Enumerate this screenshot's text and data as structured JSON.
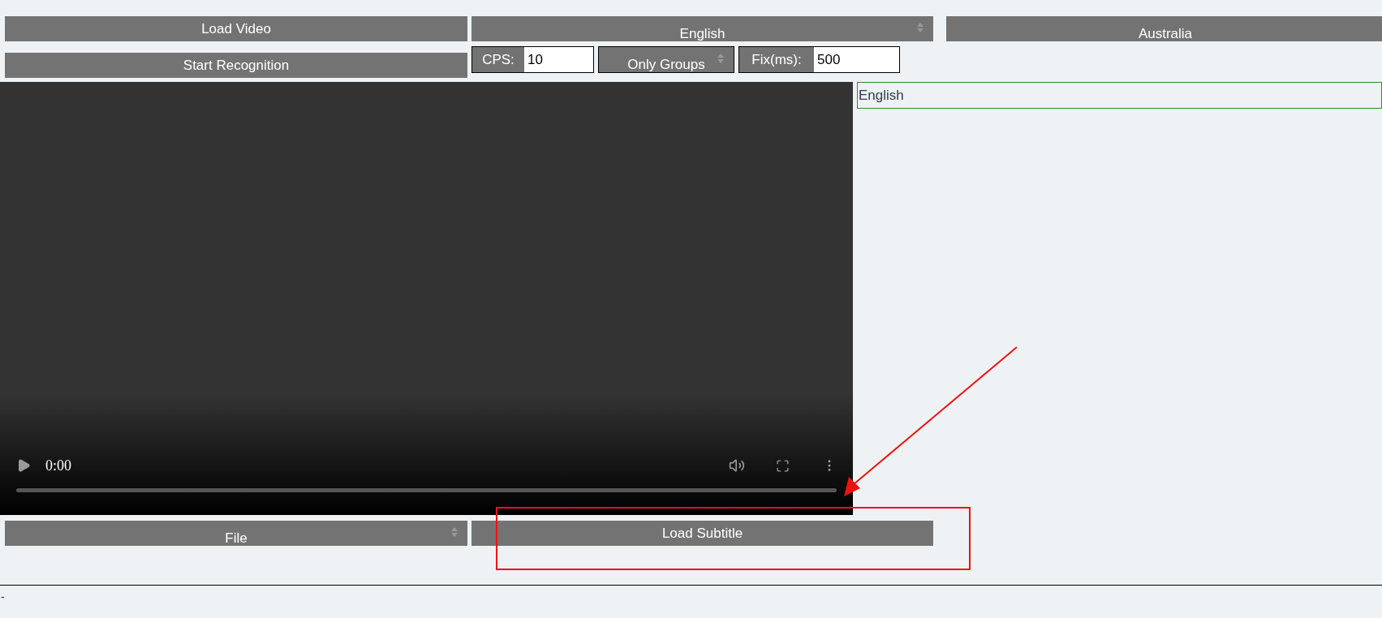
{
  "toolbar": {
    "load_video_button": "Load Video",
    "language_select": {
      "value": "English"
    },
    "region_select": {
      "value": "Australia"
    },
    "start_recognition_button": "Start Recognition",
    "cps": {
      "label": "CPS:",
      "value": "10"
    },
    "mode_select": {
      "value": "Only Groups"
    },
    "fix": {
      "label": "Fix(ms):",
      "value": "500"
    }
  },
  "video_player": {
    "time": "0:00",
    "level": 0
  },
  "results_panel": {
    "text": "English"
  },
  "source_select": {
    "value": "File"
  },
  "load_subtitle_button": "Load Subtitle",
  "status_bar": {
    "text": "-"
  }
}
